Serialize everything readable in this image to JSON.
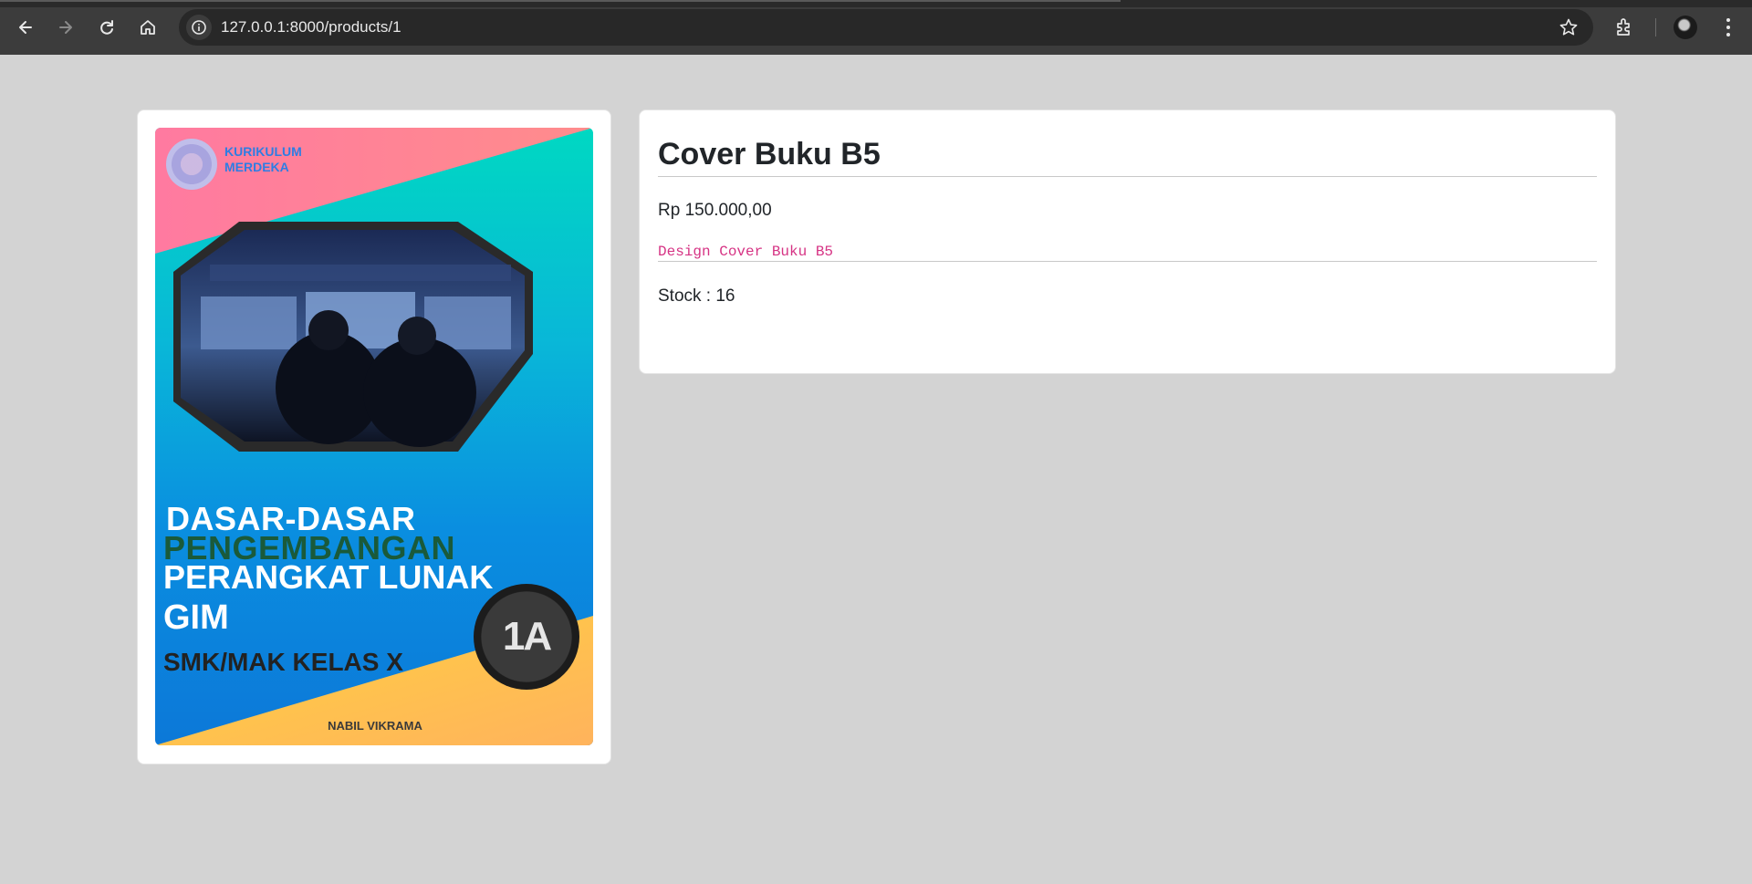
{
  "browser": {
    "url": "127.0.0.1:8000/products/1"
  },
  "cover": {
    "logo_line1": "KURIKULUM",
    "logo_line2": "MERDEKA",
    "title_line1": "DASAR-DASAR",
    "title_line2": "PENGEMBANGAN",
    "title_line3": "PERANGKAT LUNAK",
    "title_line4": "GIM",
    "subtitle": "SMK/MAK KELAS X",
    "badge": "1A",
    "author": "NABIL VIKRAMA"
  },
  "product": {
    "title": "Cover Buku B5",
    "price": "Rp 150.000,00",
    "description": "Design Cover Buku B5",
    "stock": "Stock : 16"
  },
  "colors": {
    "page_bg": "#d3d3d3",
    "description": "#d63384",
    "heading": "#212529"
  }
}
